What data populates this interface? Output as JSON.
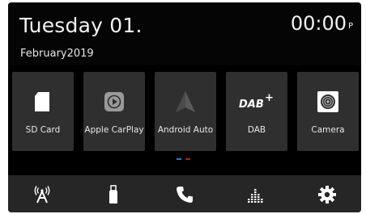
{
  "status": {
    "date_day": "Tuesday 01.",
    "date_month_year": "February2019",
    "time": "00:00",
    "time_suffix": "P"
  },
  "apps": [
    {
      "label": "SD Card",
      "icon": "sd-card-icon"
    },
    {
      "label": "Apple CarPlay",
      "icon": "carplay-icon"
    },
    {
      "label": "Android Auto",
      "icon": "android-auto-icon"
    },
    {
      "label": "DAB",
      "icon": "dab-icon"
    },
    {
      "label": "Camera",
      "icon": "camera-icon"
    }
  ],
  "pagination": {
    "active_color": "#2b7bbd",
    "inactive_color": "#9a2b2b"
  },
  "bottom_nav": [
    {
      "icon": "radio-antenna-icon"
    },
    {
      "icon": "usb-icon"
    },
    {
      "icon": "phone-icon"
    },
    {
      "icon": "equalizer-icon"
    },
    {
      "icon": "settings-gear-icon"
    }
  ],
  "colors": {
    "background": "#000000",
    "tile": "#2f2f2f",
    "bottom_bar": "#262626",
    "text": "#f2f2f2"
  }
}
